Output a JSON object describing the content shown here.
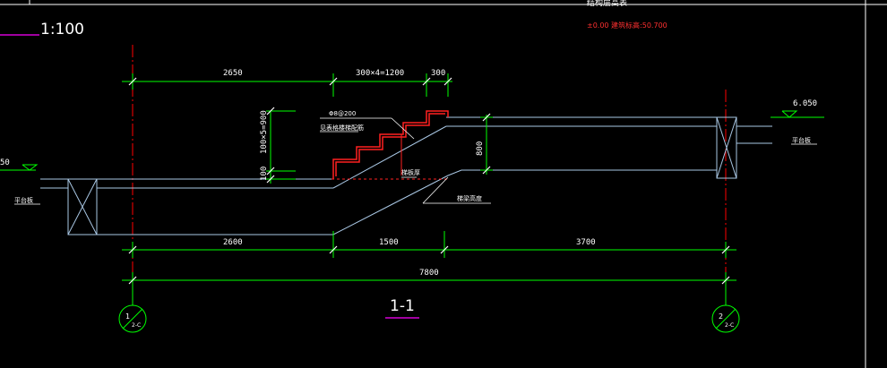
{
  "colors": {
    "background": "#000000",
    "structure": "#a9c7e4",
    "dimension": "#00ff00",
    "rebar": "#ff2020",
    "axis": "#ff0000",
    "text": "#ffffff",
    "magenta": "#ff00ff",
    "frame": "#ffffff"
  },
  "scale_label": "1:100",
  "header": {
    "title": "结构层高表",
    "subtitle": "±0.00 建筑标高:50.700"
  },
  "section_title": "1-1",
  "top_dims": [
    "2650",
    "300×4=1200",
    "300"
  ],
  "vertical_dims": [
    "100×5=900",
    "100"
  ],
  "rise_dim": "800",
  "bottom_dims": [
    "2600",
    "1500",
    "3700"
  ],
  "total_dim": "7800",
  "elevation_right": "6.050",
  "elevation_left": "50",
  "annotations": {
    "rebar_spec": "Φ8@200",
    "rebar_note": "见表格楼梯配筋",
    "stair_slab": "梯板厚",
    "bearing_note": "梯梁高度",
    "left_tag": "平台板",
    "right_tag": "平台板"
  },
  "axes": [
    {
      "num": "1",
      "sub": "2-C"
    },
    {
      "num": "2",
      "sub": "2-C"
    }
  ]
}
